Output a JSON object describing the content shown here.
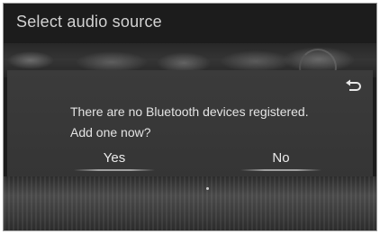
{
  "screen": {
    "title": "Select audio source"
  },
  "dialog": {
    "message_line1": "There are no Bluetooth devices registered.",
    "message_line2": "Add one now?",
    "yes_label": "Yes",
    "no_label": "No",
    "back_icon": "back-return-icon"
  },
  "colors": {
    "screen_background": "#1c1c1c",
    "dialog_background": "#3b3b3b",
    "text": "#e4e4e4"
  }
}
